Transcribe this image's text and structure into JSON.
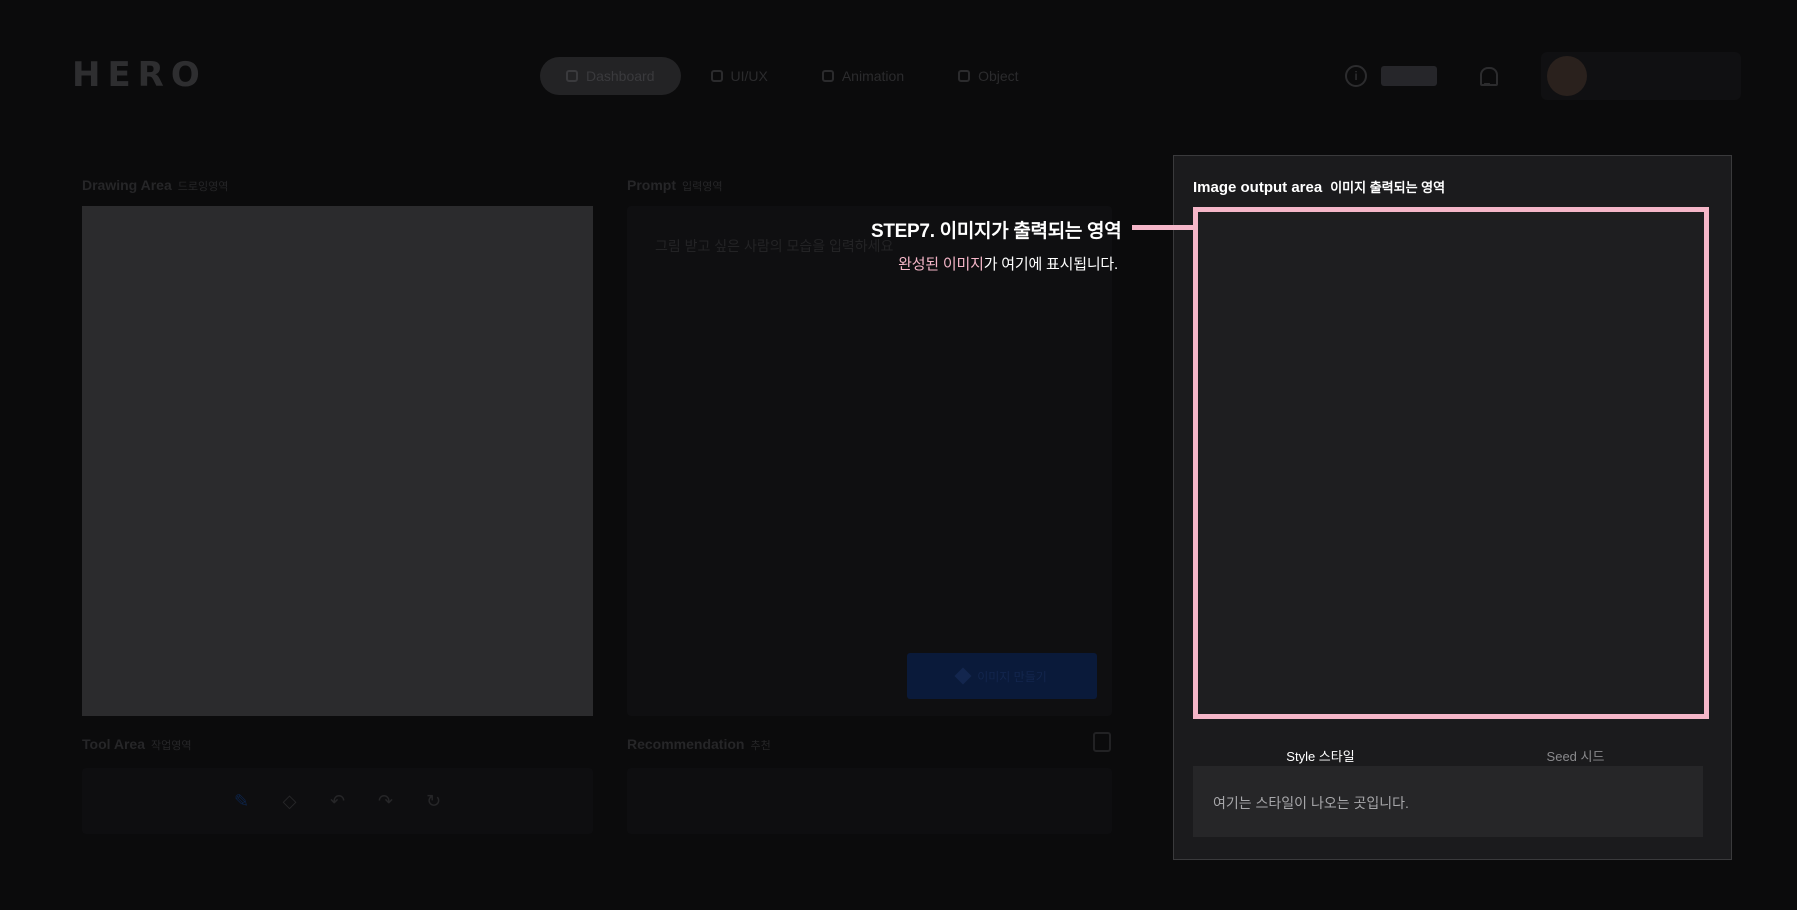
{
  "header": {
    "logo_text": "HERO",
    "nav": [
      {
        "label": "Dashboard",
        "active": true
      },
      {
        "label": "UI/UX",
        "active": false
      },
      {
        "label": "Animation",
        "active": false
      },
      {
        "label": "Object",
        "active": false
      }
    ]
  },
  "drawing_area": {
    "title": "Drawing Area",
    "subtitle": "드로잉영역"
  },
  "prompt_area": {
    "title": "Prompt",
    "subtitle": "입력영역",
    "placeholder": "그림 받고 싶은 사람의 모습을 입력하세요",
    "generate_label": "이미지 만들기"
  },
  "tool_area": {
    "title": "Tool Area",
    "subtitle": "작업영역"
  },
  "recommendation": {
    "title": "Recommendation",
    "subtitle": "추천"
  },
  "output_panel": {
    "title": "Image output area",
    "subtitle": "이미지 출력되는 영역",
    "tabs": [
      {
        "label": "Style 스타일",
        "active": true
      },
      {
        "label": "Seed 시드",
        "active": false
      }
    ],
    "tab_content": "여기는 스타일이 나오는 곳입니다."
  },
  "callout": {
    "title": "STEP7. 이미지가 출력되는 영역",
    "desc_accent": "완성된 이미지",
    "desc_rest": "가 여기에 표시됩니다."
  },
  "colors": {
    "accent_pink": "#f5b6c8",
    "panel_bg": "#1b1b1d",
    "page_bg": "#000000"
  }
}
